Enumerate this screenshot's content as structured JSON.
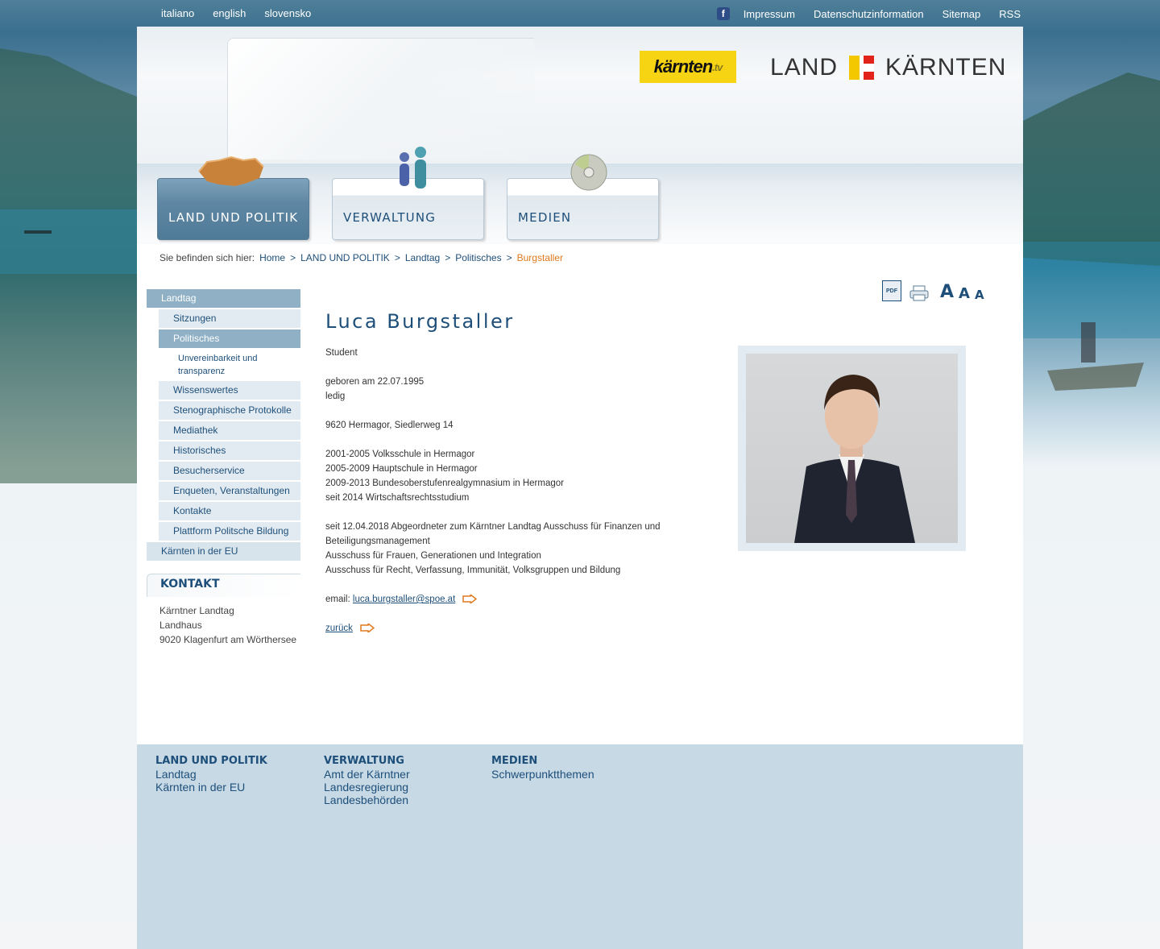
{
  "topbar": {
    "languages": [
      "italiano",
      "english",
      "slovensko"
    ],
    "links": [
      "Impressum",
      "Datenschutzinformation",
      "Sitemap",
      "RSS"
    ]
  },
  "header": {
    "ktv_logo": "kärnten",
    "ktv_suffix": ".tv",
    "land_left": "LAND",
    "land_right": "KÄRNTEN",
    "colors": {
      "yellow": "#f4c800",
      "red": "#e2231a"
    }
  },
  "nav": {
    "tabs": [
      "LAND UND POLITIK",
      "VERWALTUNG",
      "MEDIEN"
    ]
  },
  "breadcrumb": {
    "prefix": "Sie befinden sich hier:",
    "items": [
      "Home",
      "LAND UND POLITIK",
      "Landtag",
      "Politisches"
    ],
    "current": "Burgstaller",
    "separator": ">"
  },
  "sidebar": {
    "landtag": "Landtag",
    "sub": [
      "Sitzungen",
      "Politisches"
    ],
    "subsub": "Unvereinbarkeit und transparenz",
    "sub2": [
      "Wissenswertes",
      "Stenographische Protokolle",
      "Mediathek",
      "Historisches",
      "Besucherservice",
      "Enqueten, Veranstaltungen",
      "Kontakte",
      "Plattform Politsche Bildung"
    ],
    "eu": "Kärnten in der EU"
  },
  "kontakt": {
    "heading": "KONTAKT",
    "lines": [
      "Kärntner Landtag",
      "Landhaus",
      "9020 Klagenfurt am Wörthersee"
    ]
  },
  "tools": {
    "pdf": "PDF",
    "font_sizes": [
      "A",
      "A",
      "A"
    ]
  },
  "person": {
    "name": "Luca Burgstaller",
    "job": "Student",
    "born": "geboren am 22.07.1995",
    "status": "ledig",
    "address": "9620 Hermagor, Siedlerweg 14",
    "education": [
      "2001-2005 Volksschule in Hermagor",
      "2005-2009 Hauptschule in Hermagor",
      "2009-2013 Bundesoberstufenrealgymnasium in Hermagor",
      "seit 2014 Wirtschaftsrechtsstudium"
    ],
    "roles": [
      "seit 12.04.2018 Abgeordneter zum Kärntner Landtag Ausschuss für Finanzen und Beteiligungsmanagement",
      "Ausschuss für Frauen, Generationen und Integration",
      "Ausschuss für Recht, Verfassung, Immunität, Volksgruppen und Bildung"
    ],
    "email_label": "email:",
    "email": "luca.burgstaller@spoe.at",
    "back": "zurück"
  },
  "footer": {
    "col1": {
      "heading": "LAND UND POLITIK",
      "links": [
        "Landtag",
        "Kärnten in der EU"
      ]
    },
    "col2": {
      "heading": "VERWALTUNG",
      "links": [
        "Amt der Kärntner",
        "Landesregierung",
        "Landesbehörden"
      ]
    },
    "col3": {
      "heading": "MEDIEN",
      "links": [
        "Schwerpunktthemen"
      ]
    }
  }
}
